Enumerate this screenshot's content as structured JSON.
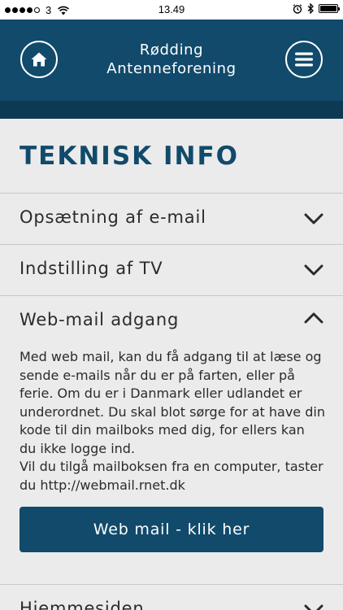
{
  "status_bar": {
    "carrier": "3",
    "time": "13.49",
    "signal_bars_filled": 4,
    "signal_bars_total": 5,
    "icons": [
      "wifi-icon",
      "alarm-icon",
      "bluetooth-icon",
      "battery-icon"
    ]
  },
  "header": {
    "title_line1": "Rødding",
    "title_line2": "Antenneforening",
    "home_icon": "home-icon",
    "menu_icon": "hamburger-menu-icon",
    "color": "#114a6b"
  },
  "page": {
    "title": "TEKNISK INFO"
  },
  "accordion": [
    {
      "label": "Opsætning af e-mail",
      "expanded": false
    },
    {
      "label": "Indstilling af TV",
      "expanded": false
    },
    {
      "label": "Web-mail adgang",
      "expanded": true,
      "body_line1": "Med web mail, kan du få adgang til at læse og sende e-mails når du er på farten, eller på ferie. Om du er i Danmark eller udlandet er underordnet. Du skal blot sørge for at have din kode til din mailboks med dig, for ellers kan du ikke logge ind.",
      "body_line2": "Vil du tilgå mailboksen fra en computer, taster du http://webmail.rnet.dk",
      "button_label": "Web mail - klik her"
    },
    {
      "label": "Hjemmesiden",
      "expanded": false
    }
  ]
}
